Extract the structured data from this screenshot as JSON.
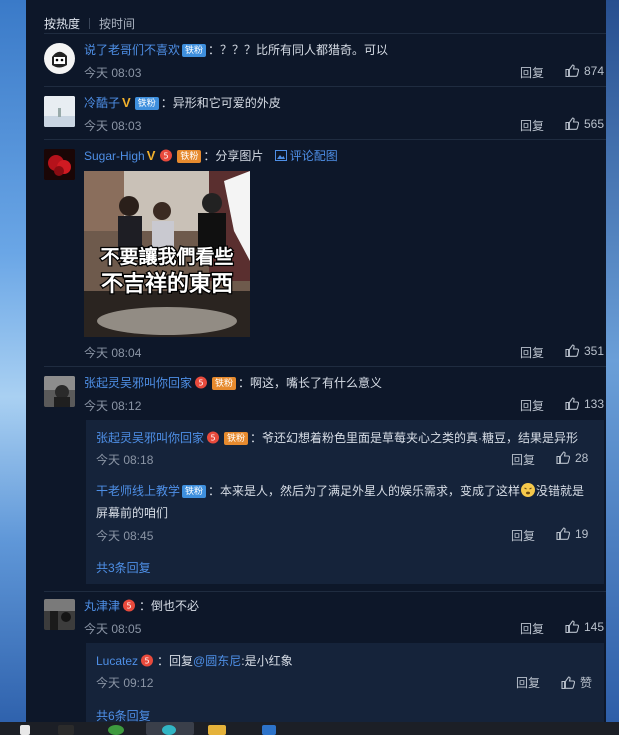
{
  "sort": {
    "hot": "按热度",
    "time": "按时间"
  },
  "comments": [
    {
      "user": "说了老哥们不喜欢",
      "badge": "铁粉",
      "text": "：？？？比所有同人都猎奇。可以",
      "time": "今天 08:03",
      "reply": "回复",
      "likes": "874"
    },
    {
      "user": "冷酷子",
      "badge": "铁粉",
      "text": "：异形和它可爱的外皮",
      "time": "今天 08:03",
      "reply": "回复",
      "likes": "565"
    },
    {
      "user": "Sugar-High",
      "badge": "铁粉",
      "text": "：分享图片",
      "extra": "评论配图",
      "image_caption_1": "不要讓我們看些",
      "image_caption_2": "不吉祥的東西",
      "time": "今天 08:04",
      "reply": "回复",
      "likes": "351"
    },
    {
      "user": "张起灵吴邪叫你回家",
      "badge": "铁粉",
      "text": "：啊这，嘴长了有什么意义",
      "time": "今天 08:12",
      "reply": "回复",
      "likes": "133"
    },
    {
      "user": "丸津津",
      "text": "：倒也不必",
      "time": "今天 08:05",
      "reply": "回复",
      "likes": "145"
    }
  ],
  "subreplies_1": [
    {
      "user": "张起灵吴邪叫你回家",
      "badge": "铁粉",
      "text": "：爷还幻想着粉色里面是草莓夹心之类的真·糖豆，结果是异形",
      "time": "今天 08:18",
      "reply": "回复",
      "likes": "28"
    },
    {
      "user": "干老师线上教学",
      "badge": "铁粉",
      "text_1": "：本来是人，然后为了满足外星人的娱乐需求，变成了这样",
      "text_2": "没错就是",
      "text_3": "屏幕前的咱们",
      "time": "今天 08:45",
      "reply": "回复",
      "likes": "19"
    }
  ],
  "more_1": "共3条回复",
  "subreplies_2": [
    {
      "user": "Lucatez",
      "prefix": "：回复",
      "mention": "@圆东尼",
      "text": ":是小红象",
      "time": "今天 09:12",
      "reply": "回复",
      "likes": "赞"
    }
  ],
  "more_2": "共6条回复",
  "colors": {
    "background": "#0d1729",
    "name": "#4e8fe6",
    "badge": "#3e8fdd",
    "subreply_bg": "#15233a"
  },
  "icons": [
    "thumbs-up-icon",
    "image-icon",
    "vip-v-icon",
    "fan-badge-icon",
    "emoji-icon"
  ]
}
